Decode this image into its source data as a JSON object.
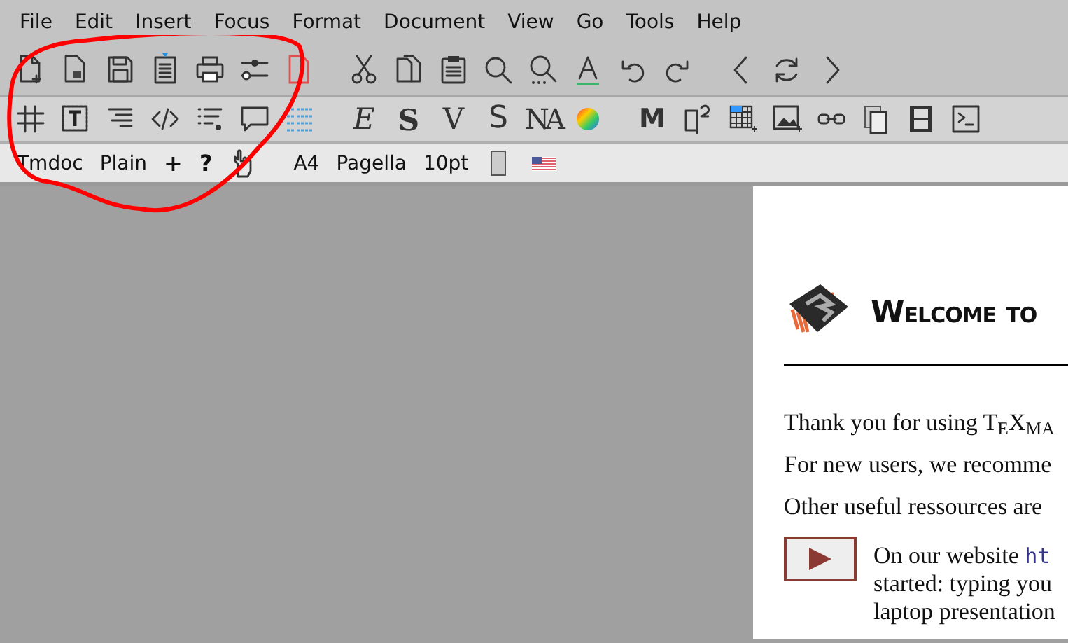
{
  "menu": [
    "File",
    "Edit",
    "Insert",
    "Focus",
    "Format",
    "Document",
    "View",
    "Go",
    "Tools",
    "Help"
  ],
  "toolbar_main": [
    {
      "kind": "new"
    },
    {
      "kind": "open"
    },
    {
      "kind": "save"
    },
    {
      "kind": "export"
    },
    {
      "kind": "print"
    },
    {
      "kind": "preferences"
    },
    {
      "kind": "close"
    },
    {
      "kind": "gap"
    },
    {
      "kind": "cut"
    },
    {
      "kind": "copy"
    },
    {
      "kind": "paste"
    },
    {
      "kind": "search"
    },
    {
      "kind": "replace"
    },
    {
      "kind": "textcolor"
    },
    {
      "kind": "undo"
    },
    {
      "kind": "redo"
    },
    {
      "kind": "gap"
    },
    {
      "kind": "back"
    },
    {
      "kind": "reload"
    },
    {
      "kind": "forward"
    }
  ],
  "toolbar_insert": [
    {
      "kind": "hash"
    },
    {
      "kind": "textbox"
    },
    {
      "kind": "align"
    },
    {
      "kind": "code"
    },
    {
      "kind": "list"
    },
    {
      "kind": "comment"
    },
    {
      "kind": "bluelist"
    },
    {
      "kind": "gap"
    },
    {
      "kind": "glyph",
      "label": "E"
    },
    {
      "kind": "glyph",
      "label": "S"
    },
    {
      "kind": "glyph",
      "label": "V"
    },
    {
      "kind": "glyph",
      "label": "S"
    },
    {
      "kind": "glyph",
      "label": "NA"
    },
    {
      "kind": "colorwheel"
    },
    {
      "kind": "gap"
    },
    {
      "kind": "glyph",
      "label": "M"
    },
    {
      "kind": "superscript"
    },
    {
      "kind": "table"
    },
    {
      "kind": "image"
    },
    {
      "kind": "link"
    },
    {
      "kind": "pages"
    },
    {
      "kind": "film"
    },
    {
      "kind": "terminal"
    }
  ],
  "format_bar": [
    {
      "kind": "text",
      "label": "Tmdoc"
    },
    {
      "kind": "text",
      "label": "Plain"
    },
    {
      "kind": "symbol",
      "label": "+"
    },
    {
      "kind": "symbol",
      "label": "?"
    },
    {
      "kind": "hand"
    },
    {
      "kind": "gap"
    },
    {
      "kind": "text",
      "label": "A4"
    },
    {
      "kind": "text",
      "label": "Pagella"
    },
    {
      "kind": "text",
      "label": "10pt"
    },
    {
      "kind": "pagebox"
    },
    {
      "kind": "flag"
    }
  ],
  "document": {
    "heading": "Welcome to",
    "paragraphs": [
      {
        "kind": "text",
        "text": "Thank you for using T$_{E}$X$_{MA}$"
      },
      {
        "kind": "text",
        "text": "For new users, we recomme"
      },
      {
        "kind": "text",
        "text": "Other useful ressources are"
      },
      {
        "kind": "video",
        "lines": [
          {
            "text": "On our website ",
            "link": "ht"
          },
          {
            "text": "started: typing you"
          },
          {
            "text": "laptop presentation"
          }
        ]
      }
    ]
  }
}
